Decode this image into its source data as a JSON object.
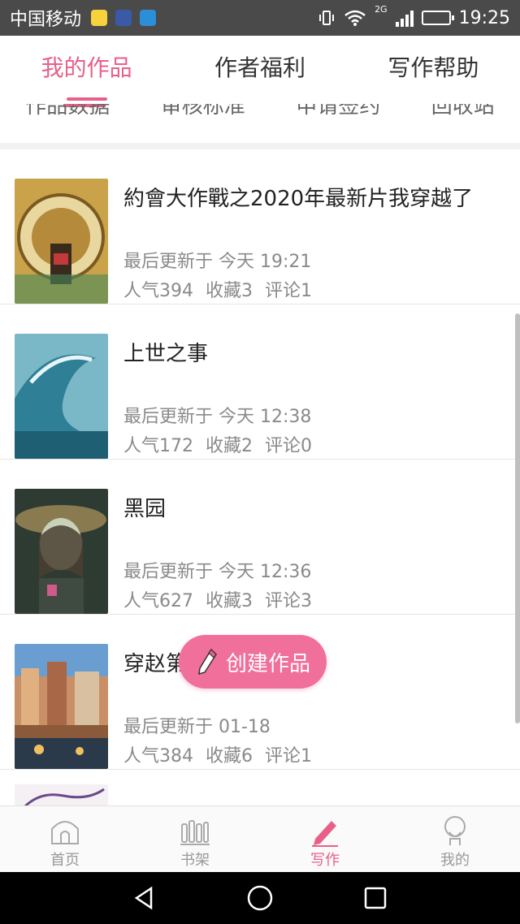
{
  "status_bar": {
    "carrier": "中国移动",
    "network": "2G",
    "time": "19:25"
  },
  "top_tabs": [
    {
      "label": "我的作品",
      "active": true
    },
    {
      "label": "作者福利",
      "active": false
    },
    {
      "label": "写作帮助",
      "active": false
    }
  ],
  "sub_tabs": [
    "作品数据",
    "审核标准",
    "申请签约",
    "回收站"
  ],
  "works": [
    {
      "title": "約會大作戰之2020年最新片我穿越了",
      "updated": "最后更新于 今天 19:21",
      "popularity": "人气394",
      "favorites": "收藏3",
      "comments": "评论1"
    },
    {
      "title": "上世之事",
      "updated": "最后更新于 今天 12:38",
      "popularity": "人气172",
      "favorites": "收藏2",
      "comments": "评论0"
    },
    {
      "title": "黑园",
      "updated": "最后更新于 今天 12:36",
      "popularity": "人气627",
      "favorites": "收藏3",
      "comments": "评论3"
    },
    {
      "title": "穿赵第",
      "updated": "最后更新于 01-18",
      "popularity": "人气384",
      "favorites": "收藏6",
      "comments": "评论1"
    }
  ],
  "fab": {
    "label": "创建作品"
  },
  "bottom_nav": [
    {
      "label": "首页",
      "icon": "home-icon",
      "active": false
    },
    {
      "label": "书架",
      "icon": "bookshelf-icon",
      "active": false
    },
    {
      "label": "写作",
      "icon": "pencil-icon",
      "active": true
    },
    {
      "label": "我的",
      "icon": "profile-icon",
      "active": false
    }
  ],
  "colors": {
    "accent": "#e8608a",
    "fab": "#f06f9b",
    "status_bar": "#4a4a4a"
  }
}
